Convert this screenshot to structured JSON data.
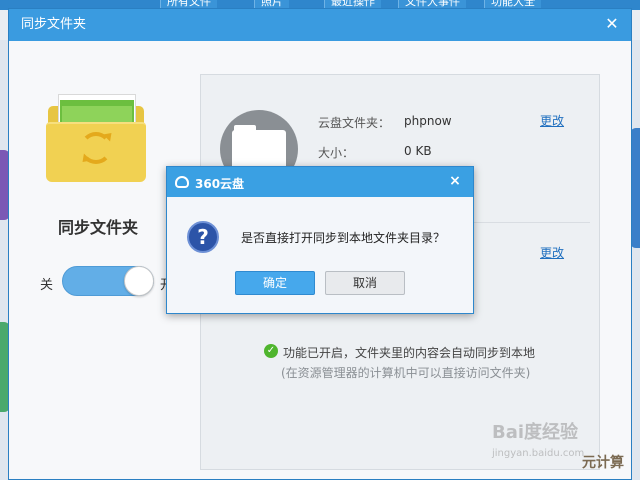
{
  "background_app": {
    "tabs": [
      "所有文件",
      "照片",
      "最近操作",
      "文件大事件",
      "功能大全"
    ]
  },
  "window": {
    "title": "同步文件夹",
    "close_icon": "close-icon"
  },
  "left_panel": {
    "title": "同步文件夹",
    "toggle": {
      "off_label": "关",
      "on_label": "开",
      "state": "on"
    },
    "icon": "sync-folder-icon"
  },
  "info": {
    "folder_label": "云盘文件夹：",
    "folder_value": "phpnow",
    "size_label": "大小：",
    "size_value": "0 KB",
    "change_link_1": "更改",
    "change_link_2": "更改"
  },
  "status": {
    "icon": "check-icon",
    "text": "功能已开启，文件夹里的内容会自动同步到本地",
    "hint": "(在资源管理器的计算机中可以直接访问文件夹)"
  },
  "dialog": {
    "title": "360云盘",
    "close": "×",
    "message": "是否直接打开同步到本地文件夹目录？",
    "ok_label": "确定",
    "cancel_label": "取消",
    "icon": "question-icon"
  },
  "watermark": {
    "brand": "Bai度经验",
    "url": "jingyan.baidu.com",
    "corner": "元计算"
  },
  "colors": {
    "accent": "#3a9be0",
    "toggle": "#62aee7",
    "ok_button": "#46a8ec",
    "success": "#4fb52d"
  }
}
